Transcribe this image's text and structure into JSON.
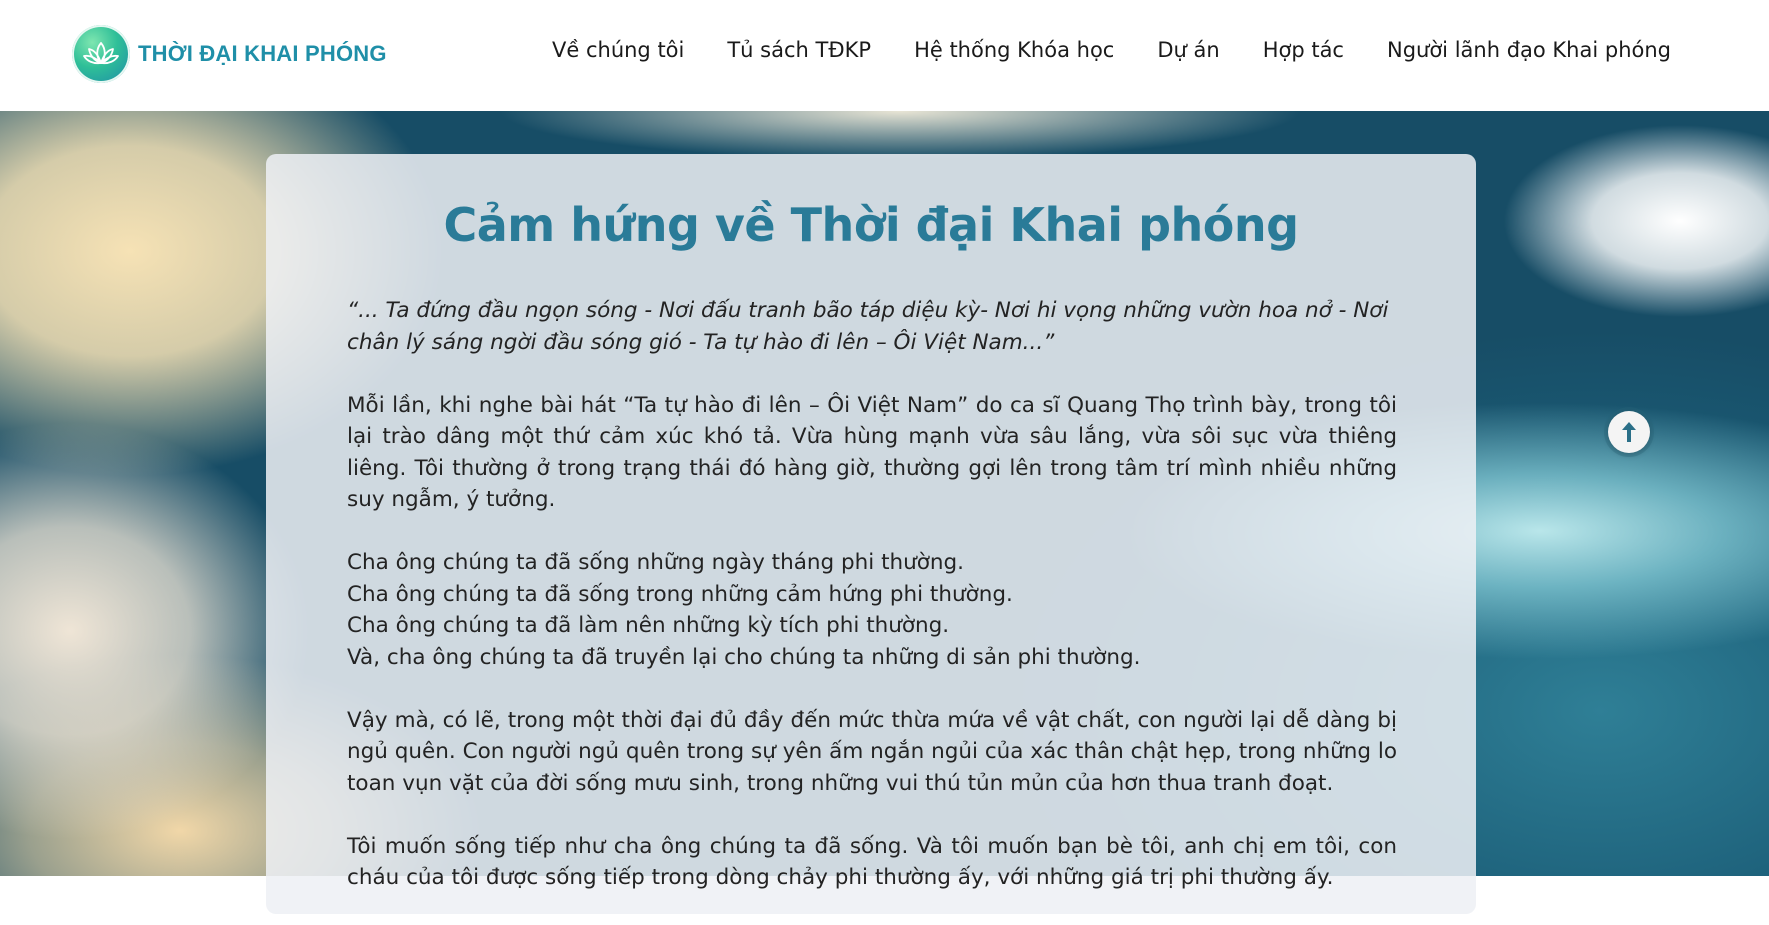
{
  "header": {
    "logo_text": "THỜI ĐẠI KHAI PHÓNG",
    "nav": [
      "Về chúng tôi",
      "Tủ sách TĐKP",
      "Hệ thống Khóa học",
      "Dự án",
      "Hợp tác",
      "Người lãnh đạo Khai phóng"
    ]
  },
  "article": {
    "title": "Cảm hứng về Thời đại Khai phóng",
    "quote": "“... Ta đứng đầu ngọn sóng - Nơi đấu tranh bão táp diệu kỳ- Nơi hi vọng những vườn hoa nở - Nơi chân lý sáng ngời đầu sóng gió - Ta tự hào đi lên – Ôi Việt Nam...”",
    "paragraph_1": "Mỗi lần, khi nghe bài hát “Ta tự hào đi lên – Ôi Việt Nam” do ca sĩ Quang Thọ trình bày, trong tôi lại trào dâng một thứ cảm xúc khó tả. Vừa hùng mạnh vừa sâu lắng, vừa sôi sục vừa thiêng liêng. Tôi thường ở trong trạng thái đó hàng giờ, thường gợi lên trong tâm trí mình nhiều những suy ngẫm, ý tưởng.",
    "lines": [
      "Cha ông chúng ta đã sống những ngày tháng phi thường.",
      "Cha ông chúng ta đã sống trong những cảm hứng phi thường.",
      "Cha ông chúng ta đã làm nên những kỳ tích phi thường.",
      "Và, cha ông chúng ta đã truyền lại cho chúng ta những di sản phi thường."
    ],
    "paragraph_2": "Vậy mà, có lẽ, trong một thời đại đủ đầy đến mức thừa mứa về vật chất, con người lại dễ dàng bị ngủ quên. Con người ngủ quên trong sự yên ấm ngắn ngủi của xác thân chật hẹp, trong những lo toan vụn vặt của đời sống mưu sinh, trong những vui thú tủn mủn của hơn thua tranh đoạt.",
    "paragraph_3": "Tôi muốn sống tiếp như cha ông chúng ta đã sống. Và tôi muốn bạn bè tôi, anh chị em tôi, con cháu của tôi được sống tiếp trong dòng chảy phi thường ấy, với những giá trị phi thường ấy."
  },
  "icons": {
    "logo": "lotus-logo-icon",
    "scroll_top": "arrow-up-icon"
  },
  "colors": {
    "title": "#2a7b98",
    "logo_text": "#1f8fa8"
  }
}
